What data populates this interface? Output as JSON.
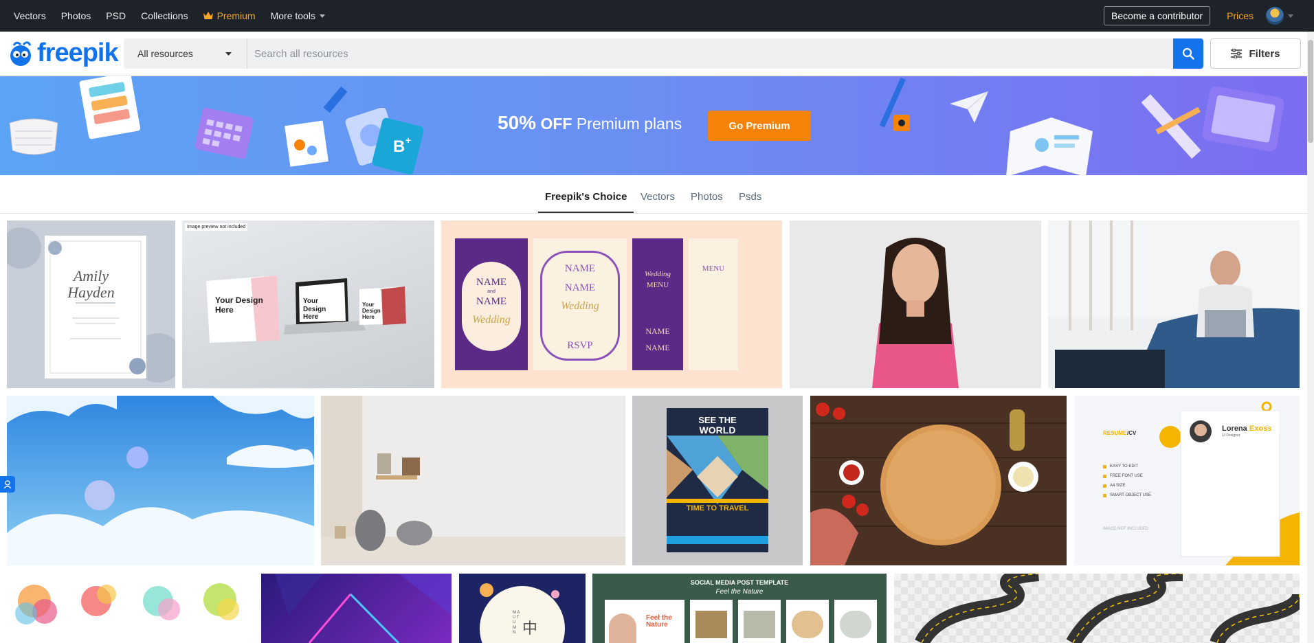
{
  "topnav": {
    "links": [
      "Vectors",
      "Photos",
      "PSD",
      "Collections"
    ],
    "premium": "Premium",
    "more_tools": "More tools",
    "become_contributor": "Become a contributor",
    "prices": "Prices"
  },
  "logo": {
    "text": "freepik"
  },
  "search": {
    "category": "All resources",
    "placeholder": "Search all resources",
    "filters": "Filters"
  },
  "banner": {
    "percent": "50%",
    "off": "OFF",
    "plans": "Premium plans",
    "cta": "Go Premium"
  },
  "tabs": [
    "Freepik's Choice",
    "Vectors",
    "Photos",
    "Psds"
  ],
  "tiles": {
    "wedding_card": {
      "line1": "Amily",
      "line2": "Hayden"
    },
    "mockup": {
      "preview_tag": "Image preview not included",
      "text1": "Your Design Here",
      "text2": "Your Design Here",
      "text3": "Your Design Here"
    },
    "wedding_set": {
      "name1": "NAME",
      "and": "and",
      "name2": "NAME",
      "wedding": "Wedding",
      "menu": "MENU",
      "rsvp": "RSVP"
    },
    "travel": {
      "headline1": "SEE THE",
      "headline2": "WORLD",
      "cta": "TIME TO TRAVEL"
    },
    "resume": {
      "title_a": "RESUME",
      "title_b": "/CV",
      "name_a": "Lorena",
      "name_b": "Exoss",
      "role": "UI Designer",
      "bullets": [
        "EASY TO EDIT",
        "FREE FONT USE",
        "A4 SIZE",
        "SMART OBJECT USE"
      ],
      "note": "IMAGE NOT INCLUDED"
    },
    "social": {
      "title": "SOCIAL MEDIA POST TEMPLATE",
      "subtitle": "Feel the Nature",
      "post_text": "Feel the Nature"
    },
    "mid_autumn": {
      "side_text": "M A U T U M N",
      "glyph": "中"
    }
  },
  "colors": {
    "brand_blue": "#1273eb",
    "nav_bg": "#1e2329",
    "premium_orange": "#f5a623",
    "cta_orange": "#f5830a"
  },
  "icons": [
    "crown-icon",
    "chevron-down-icon",
    "search-icon",
    "sliders-icon",
    "freepik-logo-icon",
    "feedback-icon"
  ]
}
